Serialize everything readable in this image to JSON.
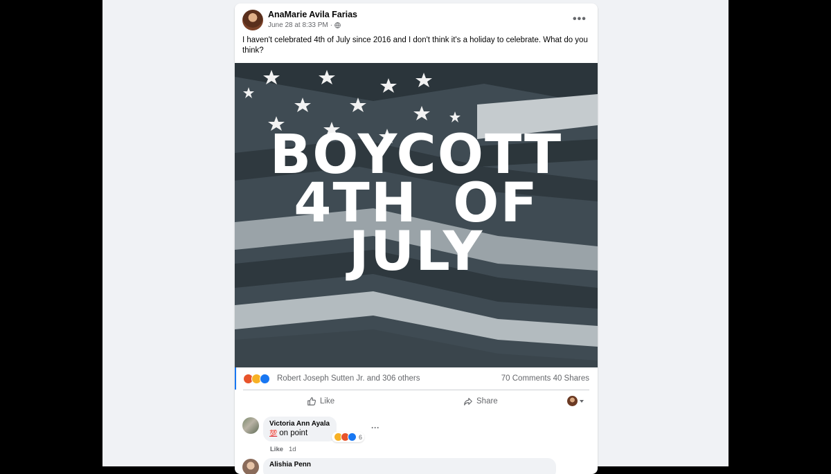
{
  "post": {
    "author": "AnaMarie Avila Farias",
    "timestamp": "June 28 at 8:33 PM",
    "timestamp_separator": "·",
    "privacy_icon": "globe-icon",
    "text": "I haven't celebrated 4th of July since 2016 and I don't think it's a holiday to celebrate. What do you think?",
    "image_text": {
      "line1": "BOYCOTT",
      "line2": "4TH OF",
      "line3": "JULY"
    }
  },
  "stats": {
    "reaction_icons": [
      "angry-icon",
      "haha-icon",
      "like-icon"
    ],
    "reaction_names": "Robert Joseph Sutten Jr. and 306 others",
    "comments": "70 Comments",
    "shares": "40 Shares"
  },
  "actions": {
    "like_label": "Like",
    "share_label": "Share"
  },
  "comments": [
    {
      "name": "Victoria Ann Ayala",
      "emoji": "💯",
      "text": "on point",
      "reaction_count": "6",
      "like_label": "Like",
      "age": "1d"
    },
    {
      "name": "Alishia Penn"
    }
  ],
  "colors": {
    "accent": "#1877f2",
    "page_bg": "#f0f2f5",
    "secondary_text": "#65676b",
    "angry": "#e8542b",
    "haha": "#f7b125"
  }
}
